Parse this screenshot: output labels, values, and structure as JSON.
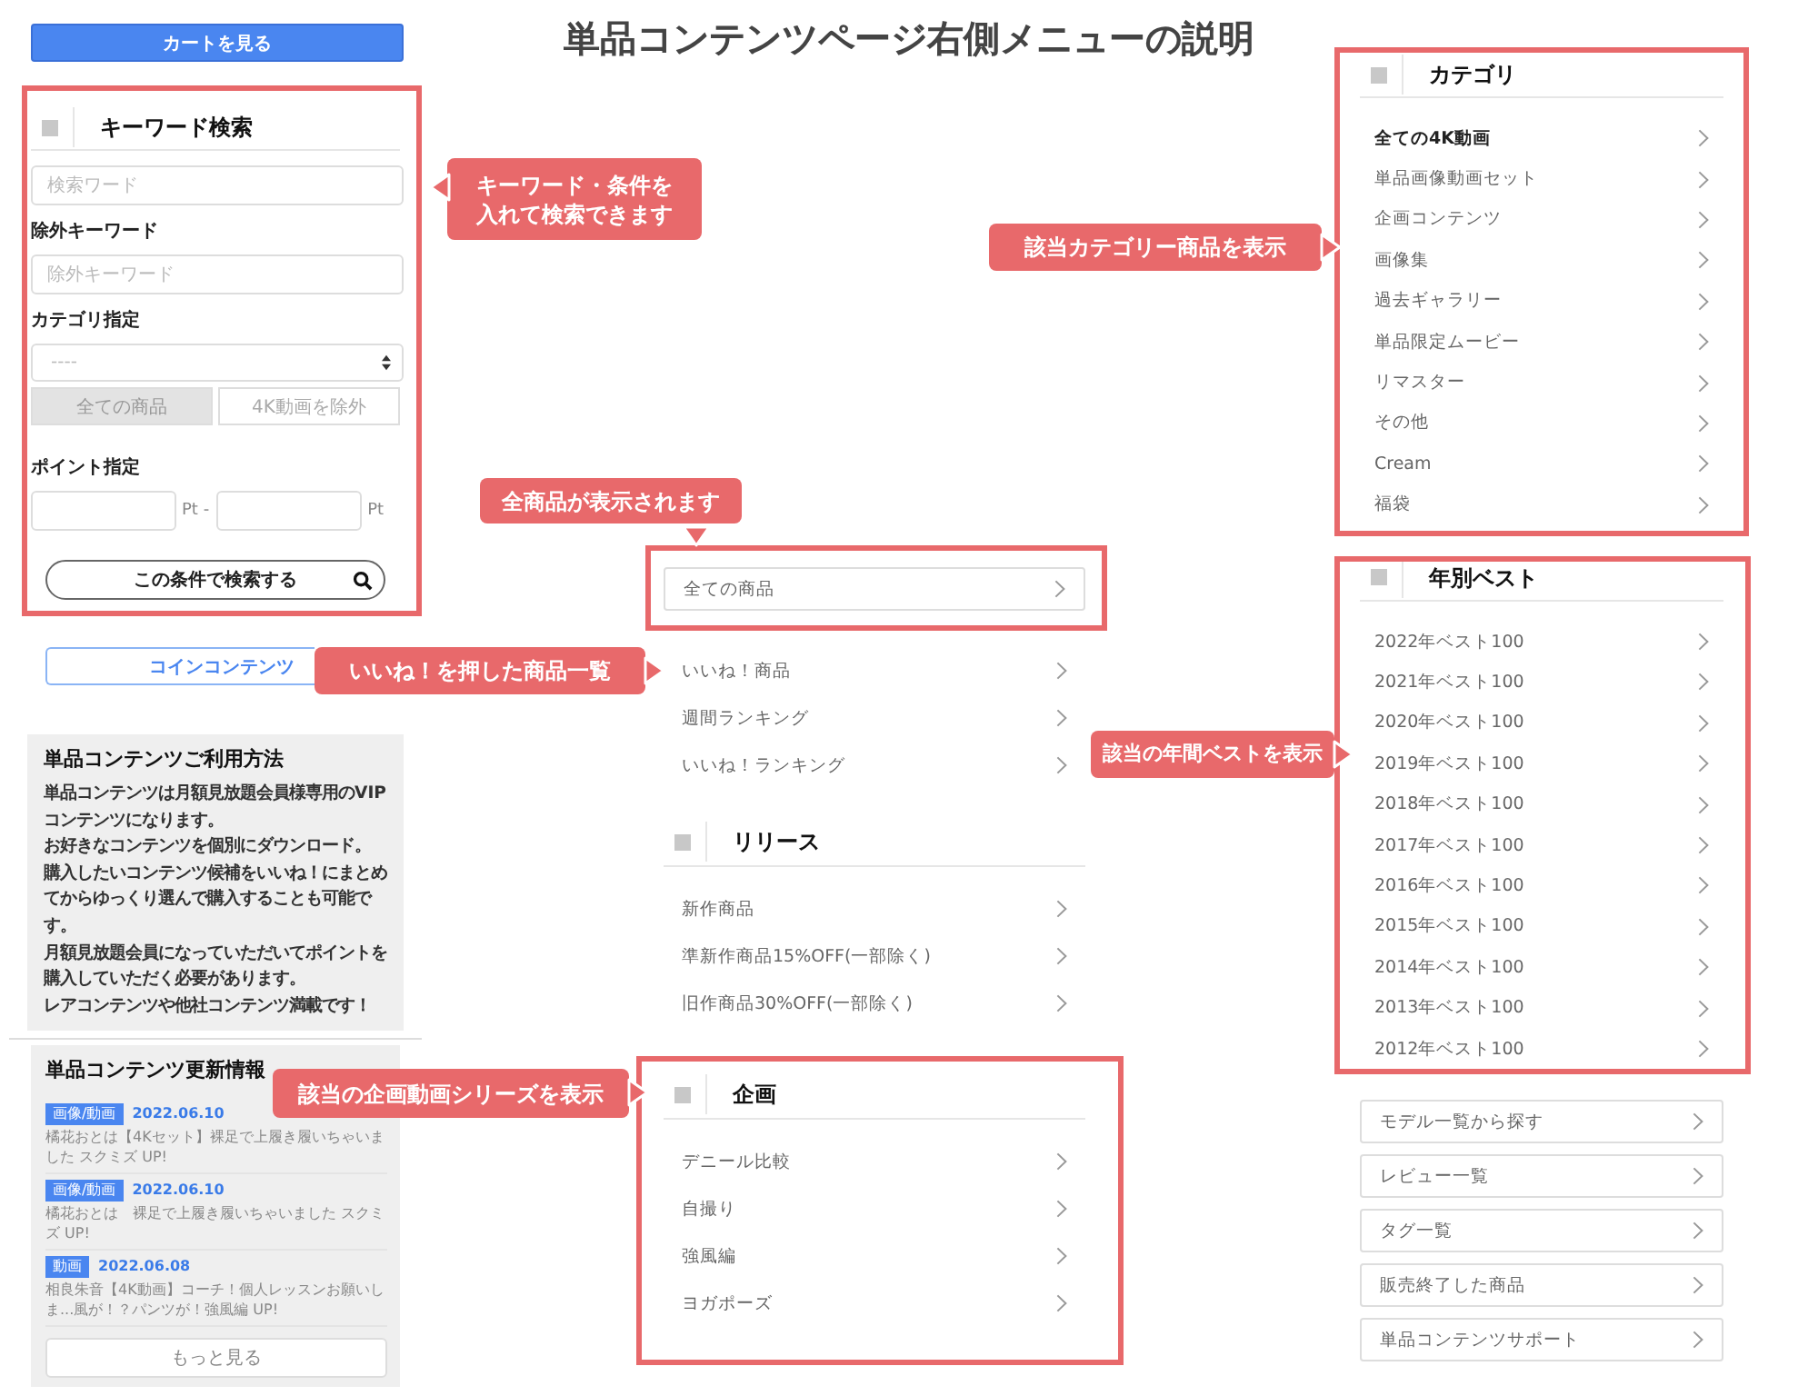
{
  "title": "単品コンテンツページ右側メニューの説明",
  "left": {
    "cart_button": "カートを見る",
    "keyword_search": {
      "heading": "キーワード検索",
      "keyword_placeholder": "検索ワード",
      "exclude_label": "除外キーワード",
      "exclude_placeholder": "除外キーワード",
      "category_label": "カテゴリ指定",
      "category_value": "----",
      "toggles": [
        {
          "label": "全ての商品",
          "selected": true
        },
        {
          "label": "4K動画を除外",
          "selected": false
        }
      ],
      "point_label": "ポイント指定",
      "point_units": [
        "Pt -",
        "Pt"
      ],
      "submit": "この条件で検索する"
    },
    "coin_button": "コインコンテンツ",
    "usage": {
      "heading": "単品コンテンツご利用方法",
      "paragraphs": [
        "単品コンテンツは月額見放題会員様専用のVIPコンテンツになります。",
        "お好きなコンテンツを個別にダウンロード。",
        "購入したいコンテンツ候補をいいね！にまとめてからゆっくり選んで購入することも可能です。",
        "月額見放題会員になっていただいてポイントを購入していただく必要があります。",
        "レアコンテンツや他社コンテンツ満載です！"
      ]
    },
    "updates": {
      "heading": "単品コンテンツ更新情報",
      "items": [
        {
          "tag": "画像/動画",
          "date": "2022.06.10",
          "text": "橘花おとは【4Kセット】裸足で上履き履いちゃいました スクミズ UP!"
        },
        {
          "tag": "画像/動画",
          "date": "2022.06.10",
          "text": "橘花おとは　裸足で上履き履いちゃいました スクミズ UP!"
        },
        {
          "tag": "動画",
          "date": "2022.06.08",
          "text": "相良朱音【4K動画】コーチ！個人レッスンお願いしま...風が！？パンツが！強風編 UP!"
        }
      ],
      "more": "もっと見る"
    }
  },
  "middle": {
    "all_products": "全ての商品",
    "links": [
      "いいね！商品",
      "週間ランキング",
      "いいね！ランキング"
    ],
    "sections": [
      {
        "heading": "リリース",
        "items": [
          "新作商品",
          "準新作商品15%OFF(一部除く)",
          "旧作商品30%OFF(一部除く)"
        ]
      },
      {
        "heading": "企画",
        "items": [
          "デニール比較",
          "自撮り",
          "強風編",
          "ヨガポーズ"
        ]
      }
    ]
  },
  "right": {
    "sections": [
      {
        "heading": "カテゴリ",
        "items": [
          {
            "label": "全ての4K動画",
            "bold": true
          },
          {
            "label": "単品画像動画セット",
            "bold": false
          },
          {
            "label": "企画コンテンツ",
            "bold": false
          },
          {
            "label": "画像集",
            "bold": false
          },
          {
            "label": "過去ギャラリー",
            "bold": false
          },
          {
            "label": "単品限定ムービー",
            "bold": false
          },
          {
            "label": "リマスター",
            "bold": false
          },
          {
            "label": "その他",
            "bold": false
          },
          {
            "label": "Cream",
            "bold": false
          },
          {
            "label": "福袋",
            "bold": false
          }
        ]
      },
      {
        "heading": "年別ベスト",
        "items": [
          {
            "label": "2022年ベスト100",
            "bold": false
          },
          {
            "label": "2021年ベスト100",
            "bold": false
          },
          {
            "label": "2020年ベスト100",
            "bold": false
          },
          {
            "label": "2019年ベスト100",
            "bold": false
          },
          {
            "label": "2018年ベスト100",
            "bold": false
          },
          {
            "label": "2017年ベスト100",
            "bold": false
          },
          {
            "label": "2016年ベスト100",
            "bold": false
          },
          {
            "label": "2015年ベスト100",
            "bold": false
          },
          {
            "label": "2014年ベスト100",
            "bold": false
          },
          {
            "label": "2013年ベスト100",
            "bold": false
          },
          {
            "label": "2012年ベスト100",
            "bold": false
          }
        ]
      }
    ],
    "link_buttons": [
      "モデル一覧から探す",
      "レビュー一覧",
      "タグ一覧",
      "販売終了した商品",
      "単品コンテンツサポート"
    ]
  },
  "callouts": [
    {
      "lines": [
        "キーワード・条件を",
        "入れて検索できます"
      ],
      "kind": "left"
    },
    {
      "lines": [
        "全商品が表示されます"
      ],
      "kind": "down"
    },
    {
      "lines": [
        "いいね！を押した商品一覧"
      ],
      "kind": "right"
    },
    {
      "lines": [
        "該当の企画動画シリーズを表示"
      ],
      "kind": "right"
    },
    {
      "lines": [
        "該当カテゴリー商品を表示"
      ],
      "kind": "right"
    },
    {
      "lines": [
        "該当の年間ベストを表示"
      ],
      "kind": "right"
    }
  ]
}
